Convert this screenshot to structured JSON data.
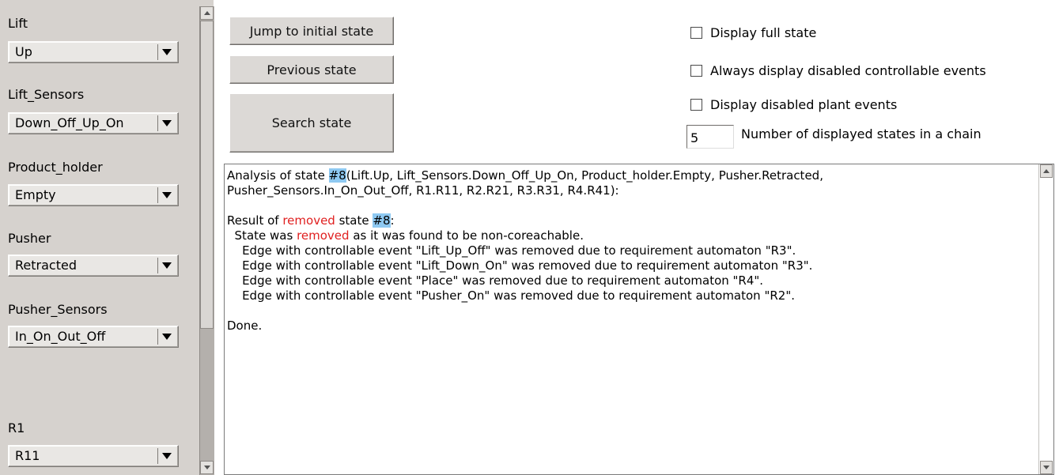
{
  "automata": [
    {
      "name": "Lift",
      "value": "Up"
    },
    {
      "name": "Lift_Sensors",
      "value": "Down_Off_Up_On"
    },
    {
      "name": "Product_holder",
      "value": "Empty"
    },
    {
      "name": "Pusher",
      "value": "Retracted"
    },
    {
      "name": "Pusher_Sensors",
      "value": "In_On_Out_Off"
    },
    {
      "name": "R1",
      "value": "R11"
    }
  ],
  "buttons": {
    "jump": "Jump to initial state",
    "previous": "Previous state",
    "search": "Search state"
  },
  "options": {
    "display_full_state": "Display full state",
    "always_display_disabled": "Always display disabled controllable events",
    "display_disabled_plant": "Display disabled plant events",
    "chain_count_value": "5",
    "chain_count_label": "Number of displayed states in a chain"
  },
  "analysis": {
    "line1_prefix": "Analysis of state ",
    "state_ref": "#8",
    "line1_suffix": "(Lift.Up, Lift_Sensors.Down_Off_Up_On, Product_holder.Empty, Pusher.Retracted,",
    "line2": "Pusher_Sensors.In_On_Out_Off, R1.R11, R2.R21, R3.R31, R4.R41):",
    "result_prefix": "Result of ",
    "removed_word": "removed",
    "result_middle": " state ",
    "result_suffix": ":",
    "removed_prefix": "  State was ",
    "removed_suffix": " as it was found to be non-coreachable.",
    "edges": [
      "    Edge with controllable event \"Lift_Up_Off\" was removed due to requirement automaton \"R3\".",
      "    Edge with controllable event \"Lift_Down_On\" was removed due to requirement automaton \"R3\".",
      "    Edge with controllable event \"Place\" was removed due to requirement automaton \"R4\".",
      "    Edge with controllable event \"Pusher_On\" was removed due to requirement automaton \"R2\"."
    ],
    "done": "Done."
  }
}
